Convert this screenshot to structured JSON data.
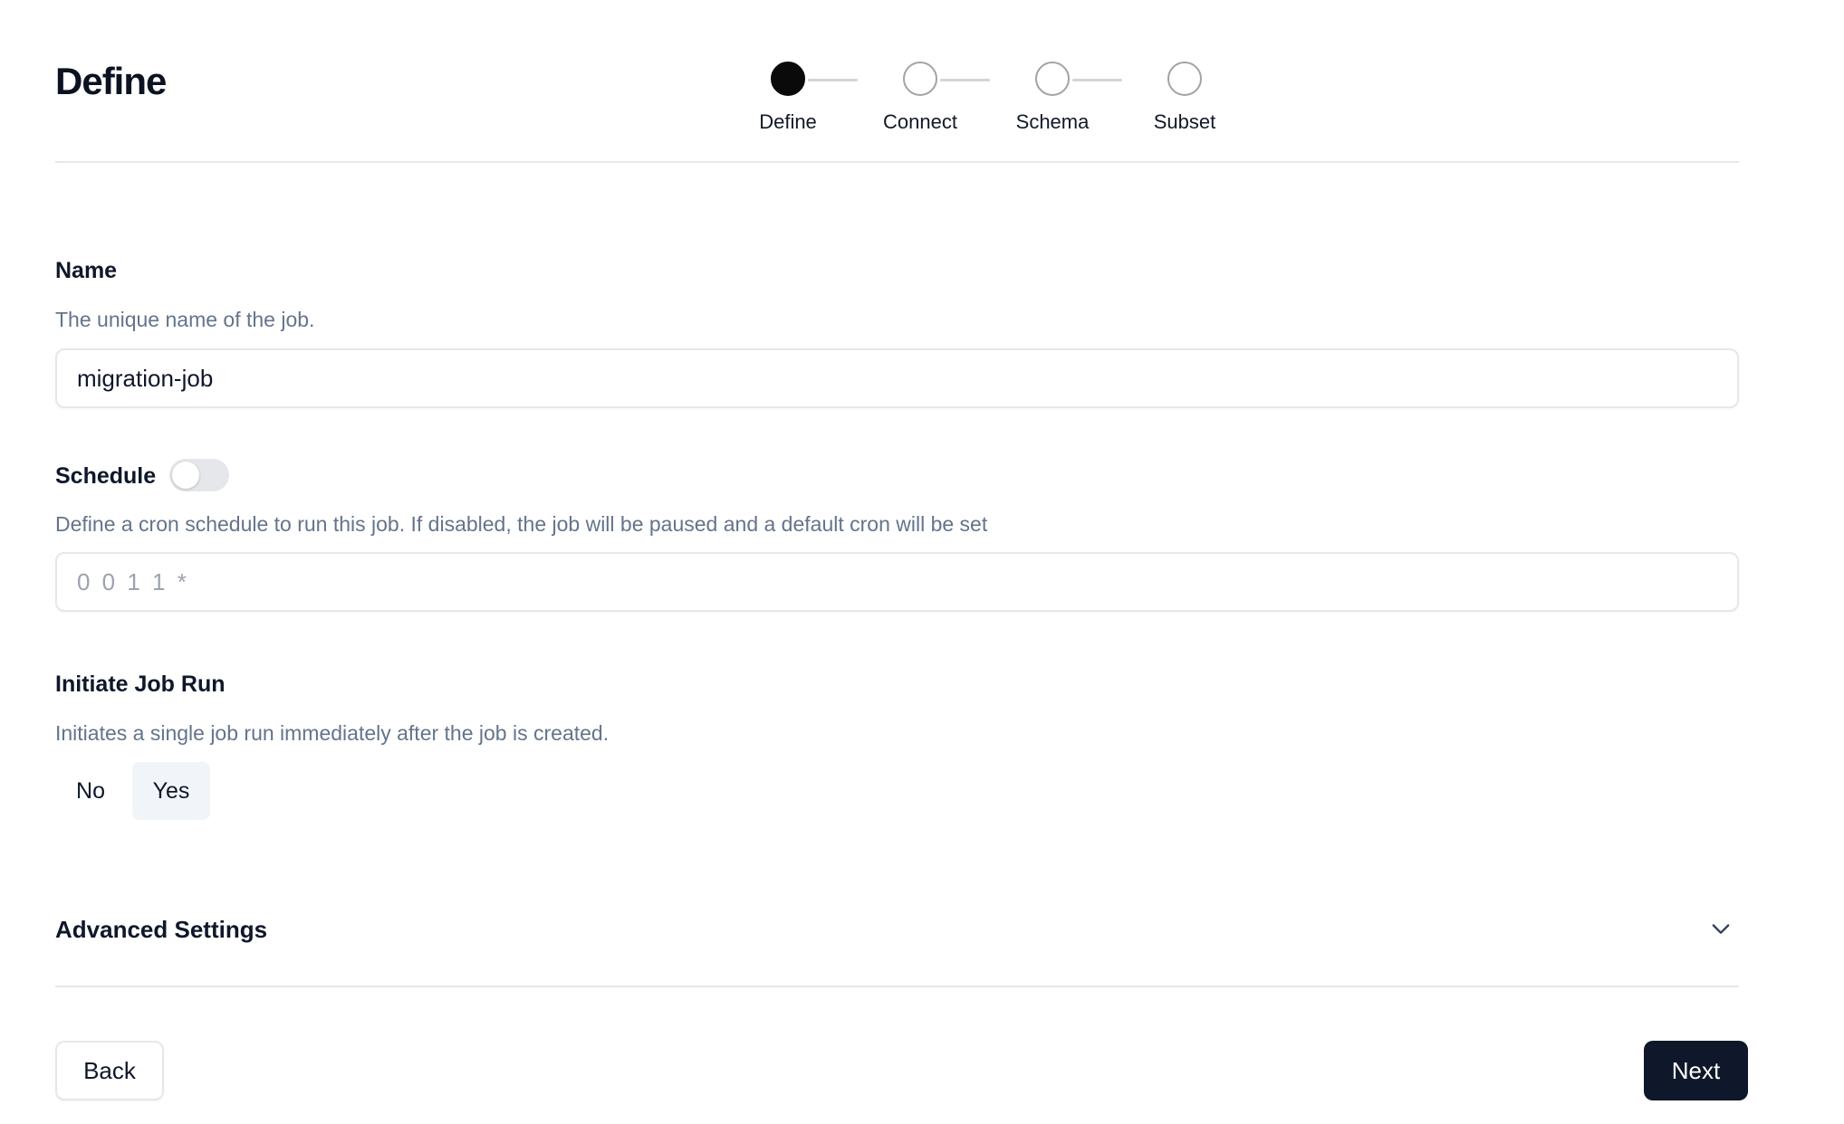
{
  "header": {
    "title": "Define"
  },
  "stepper": {
    "steps": [
      {
        "label": "Define",
        "state": "active"
      },
      {
        "label": "Connect",
        "state": "inactive"
      },
      {
        "label": "Schema",
        "state": "inactive"
      },
      {
        "label": "Subset",
        "state": "inactive"
      }
    ]
  },
  "name_field": {
    "label": "Name",
    "description": "The unique name of the job.",
    "value": "migration-job"
  },
  "schedule_field": {
    "label": "Schedule",
    "enabled": false,
    "description": "Define a cron schedule to run this job. If disabled, the job will be paused and a default cron will be set",
    "placeholder": "0 0 1 1 *",
    "value": ""
  },
  "initiate_run": {
    "label": "Initiate Job Run",
    "description": "Initiates a single job run immediately after the job is created.",
    "options": [
      "No",
      "Yes"
    ],
    "selected": "Yes"
  },
  "advanced": {
    "label": "Advanced Settings",
    "icon": "chevron-down-icon"
  },
  "footer": {
    "back_label": "Back",
    "next_label": "Next"
  },
  "colors": {
    "primary": "#0f172a",
    "muted_text": "#64748b",
    "border": "#e5e7eb",
    "selected_bg": "#f1f5f9"
  }
}
